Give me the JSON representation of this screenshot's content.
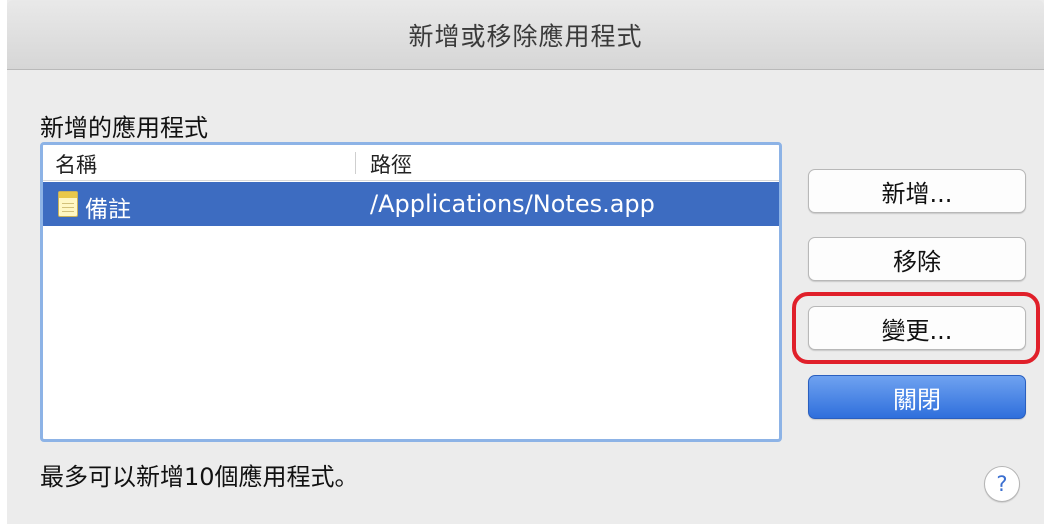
{
  "window": {
    "title": "新增或移除應用程式"
  },
  "section": {
    "label": "新增的應用程式"
  },
  "list": {
    "columns": {
      "name": "名稱",
      "path": "路徑"
    },
    "rows": [
      {
        "name": "備註",
        "path": "/Applications/Notes.app",
        "icon": "notes-app-icon",
        "selected": true
      }
    ]
  },
  "buttons": {
    "add": "新增...",
    "remove": "移除",
    "change": "變更...",
    "close": "關閉"
  },
  "footer": {
    "note": "最多可以新增10個應用程式。"
  },
  "help": {
    "label": "?"
  },
  "colors": {
    "selection": "#3d6cc1",
    "focus_ring": "#8db3e6",
    "highlight": "#e0202a",
    "primary_button": "#2f6fdc"
  }
}
